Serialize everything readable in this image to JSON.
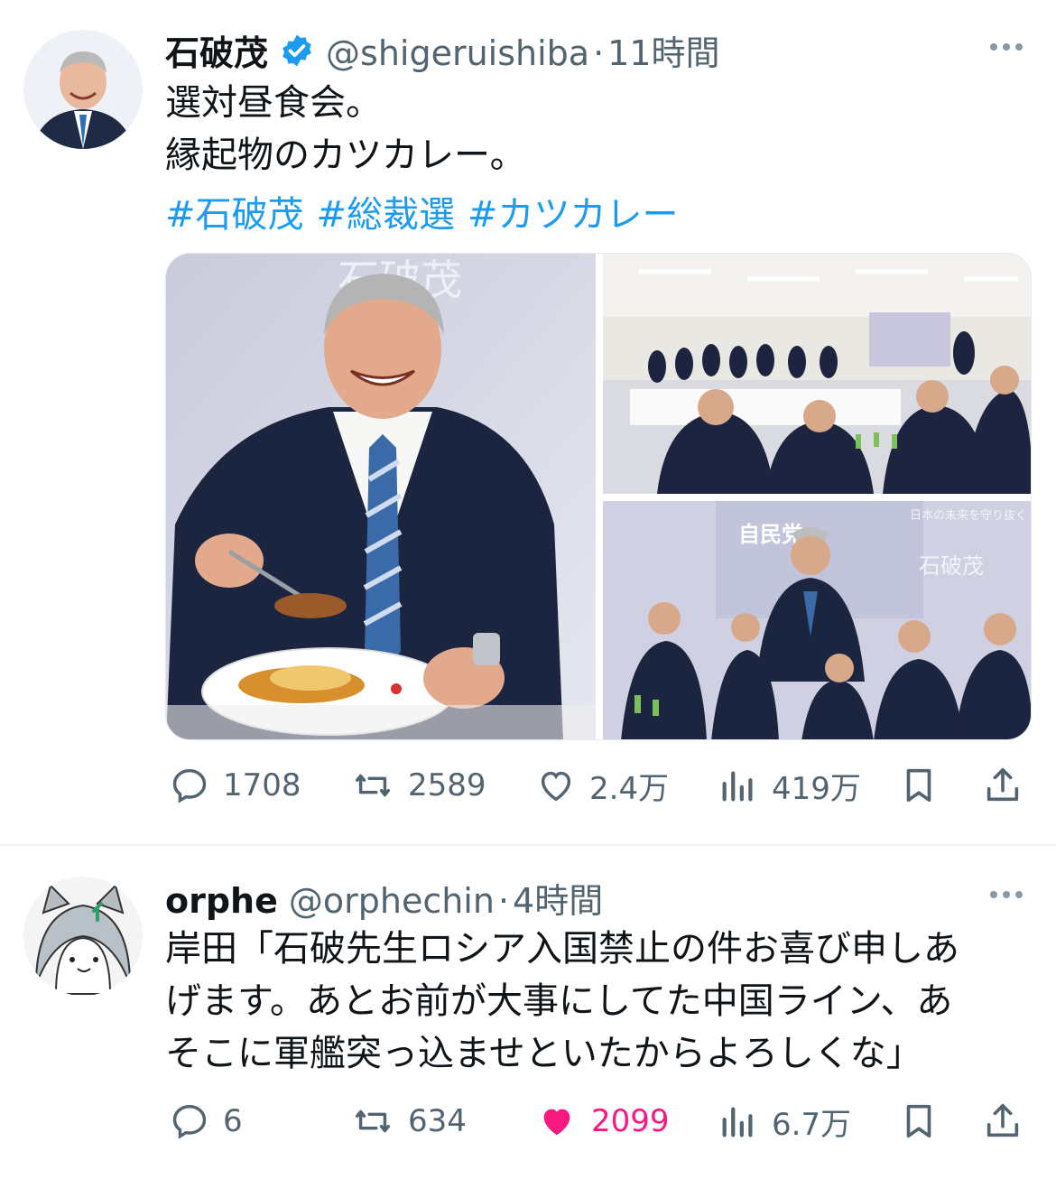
{
  "tweet1": {
    "name": "石破茂",
    "handle": "@shigeruishiba",
    "separator": "·",
    "time": "11時間",
    "text_line1": "選対昼食会。",
    "text_line2": "縁起物のカツカレー。",
    "hashtags": [
      "#石破茂",
      "#総裁選",
      "#カツカレー"
    ],
    "photo_text_1": "石破茂",
    "photo_text_2": "日本の未来を守り抜く",
    "photo_text_3": "石破茂",
    "photo_text_4": "自民党",
    "replies": "1708",
    "reposts": "2589",
    "likes": "2.4万",
    "views": "419万"
  },
  "tweet2": {
    "name": "orphe",
    "handle": "@orphechin",
    "separator": "·",
    "time": "4時間",
    "text_line1": "岸田「石破先生ロシア入国禁止の件お喜び申しあ",
    "text_line2": "げます。あとお前が大事にしてた中国ライン、あ",
    "text_line3": "そこに軍艦突っ込ませといたからよろしくな」",
    "replies": "6",
    "reposts": "634",
    "likes": "2099",
    "views": "6.7万"
  },
  "colors": {
    "accent_blue": "#1d9bf0",
    "like_pink": "#f91880",
    "secondary_text": "#536471"
  },
  "icons": [
    "verified-badge-icon",
    "more-icon",
    "reply-icon",
    "repost-icon",
    "like-icon",
    "views-icon",
    "bookmark-icon",
    "share-icon"
  ]
}
